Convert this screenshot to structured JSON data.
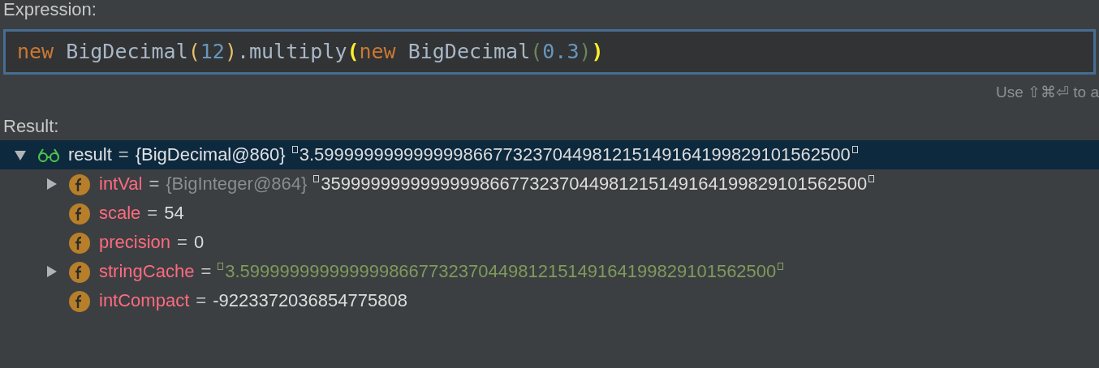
{
  "expression": {
    "label": "Expression:",
    "tokens": [
      {
        "kind": "keyword",
        "text": "new"
      },
      {
        "kind": "plain",
        "text": " BigDecimal"
      },
      {
        "kind": "paren",
        "text": "("
      },
      {
        "kind": "number",
        "text": "12"
      },
      {
        "kind": "paren",
        "text": ")"
      },
      {
        "kind": "plain",
        "text": ".multiply"
      },
      {
        "kind": "match",
        "text": "("
      },
      {
        "kind": "keyword",
        "text": "new"
      },
      {
        "kind": "plain",
        "text": " BigDecimal"
      },
      {
        "kind": "paren2",
        "text": "("
      },
      {
        "kind": "number",
        "text": "0.3"
      },
      {
        "kind": "paren2",
        "text": ")"
      },
      {
        "kind": "match",
        "text": ")"
      }
    ],
    "hint": "Use ⇧⌘⏎ to a"
  },
  "result": {
    "label": "Result:",
    "tree": [
      {
        "kind": "watch",
        "name": "result",
        "separator": "=",
        "type_ref": "{BigDecimal@860}",
        "value": {
          "kind": "quoted",
          "text": "3.599999999999999866773237044981215149164199829101562500"
        },
        "expanded": true,
        "selected": true,
        "children": [
          {
            "kind": "field",
            "name": "intVal",
            "separator": "=",
            "type_ref": "{BigInteger@864}",
            "value": {
              "kind": "quoted",
              "text": "3599999999999999866773237044981215149164199829101562500"
            },
            "expanded": false,
            "selected": false
          },
          {
            "kind": "field",
            "name": "scale",
            "separator": "=",
            "value": {
              "kind": "plain",
              "text": "54"
            },
            "selected": false
          },
          {
            "kind": "field",
            "name": "precision",
            "separator": "=",
            "value": {
              "kind": "plain",
              "text": "0"
            },
            "selected": false
          },
          {
            "kind": "field",
            "name": "stringCache",
            "separator": "=",
            "value": {
              "kind": "string",
              "text": "3.599999999999999866773237044981215149164199829101562500"
            },
            "expanded": false,
            "selected": false
          },
          {
            "kind": "field",
            "name": "intCompact",
            "separator": "=",
            "value": {
              "kind": "plain",
              "text": "-9223372036854775808"
            },
            "selected": false
          }
        ]
      }
    ]
  }
}
